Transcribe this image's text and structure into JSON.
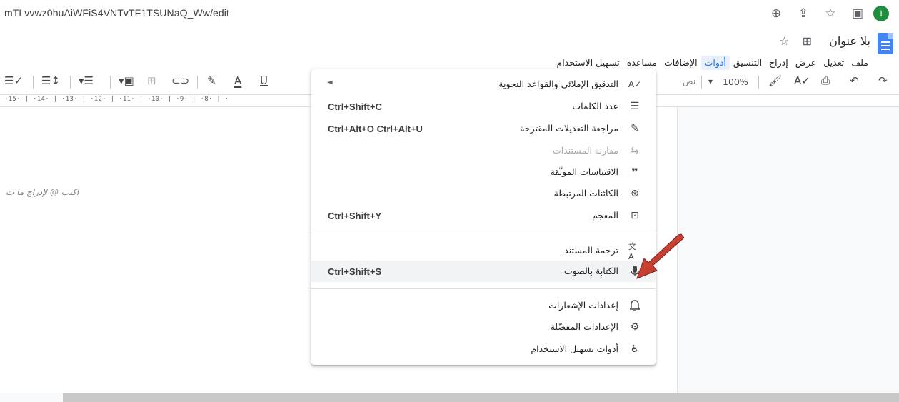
{
  "browser": {
    "url": "mTLvvwz0huAiWFiS4VNTvTF1TSUNaQ_Ww/edit",
    "icons": [
      "zoom-icon",
      "share-icon",
      "star-icon",
      "sidebar-icon"
    ],
    "avatar_letter": "I"
  },
  "doc": {
    "title": "بلا عنوان",
    "menu": [
      "ملف",
      "تعديل",
      "عرض",
      "إدراج",
      "التنسيق",
      "أدوات",
      "الإضافات",
      "مساعدة",
      "تسهيل الاستخدام"
    ],
    "active_menu": "أدوات"
  },
  "toolbar": {
    "zoom": "100%",
    "style_partial": "نص"
  },
  "ruler": "·15· | ·14· | ·13· | ·12· | ·11· | ·10· | ·9· | ·8· | ·",
  "page": {
    "placeholder": "اكتب @ لإدراج ما ت",
    "placeholder_prefix": "ا"
  },
  "tools_menu": {
    "items": [
      {
        "label": "التدقيق الإملائي والقواعد النحوية",
        "shortcut": "",
        "submenu": "◄",
        "icon": "spellcheck-icon",
        "glyph": "A✓"
      },
      {
        "label": "عدد الكلمات",
        "shortcut": "Ctrl+Shift+C",
        "icon": "word-count-icon",
        "glyph": "☰"
      },
      {
        "label": "مراجعة التعديلات المقترحة",
        "shortcut": "Ctrl+Alt+O Ctrl+Alt+U",
        "icon": "review-edits-icon",
        "glyph": "✎"
      },
      {
        "label": "مقارنة المستندات",
        "shortcut": "",
        "icon": "compare-icon",
        "glyph": "⇆",
        "disabled": true
      },
      {
        "label": "الاقتباسات الموثّقة",
        "shortcut": "",
        "icon": "quote-icon",
        "glyph": "❞"
      },
      {
        "label": "الكائنات المرتبطة",
        "shortcut": "",
        "icon": "linked-objects-icon",
        "glyph": "⊛"
      },
      {
        "label": "المعجم",
        "shortcut": "Ctrl+Shift+Y",
        "icon": "dictionary-icon",
        "glyph": "⊡"
      },
      {
        "label": "ترجمة المستند",
        "shortcut": "",
        "icon": "translate-icon",
        "glyph": "文A"
      },
      {
        "label": "الكتابة بالصوت",
        "shortcut": "Ctrl+Shift+S",
        "icon": "microphone-icon",
        "glyph": "🎙"
      },
      {
        "label": "إعدادات الإشعارات",
        "shortcut": "",
        "icon": "bell-icon",
        "glyph": "🔔"
      },
      {
        "label": "الإعدادات المفضّلة",
        "shortcut": "",
        "icon": "preferences-icon",
        "glyph": "⚙"
      },
      {
        "label": "أدوات تسهيل الاستخدام",
        "shortcut": "",
        "icon": "accessibility-icon",
        "glyph": "♿"
      }
    ]
  },
  "colors": {
    "accent": "#1a73e8",
    "arrow": "#c0392b",
    "menu_highlight": "#f1f3f4"
  }
}
